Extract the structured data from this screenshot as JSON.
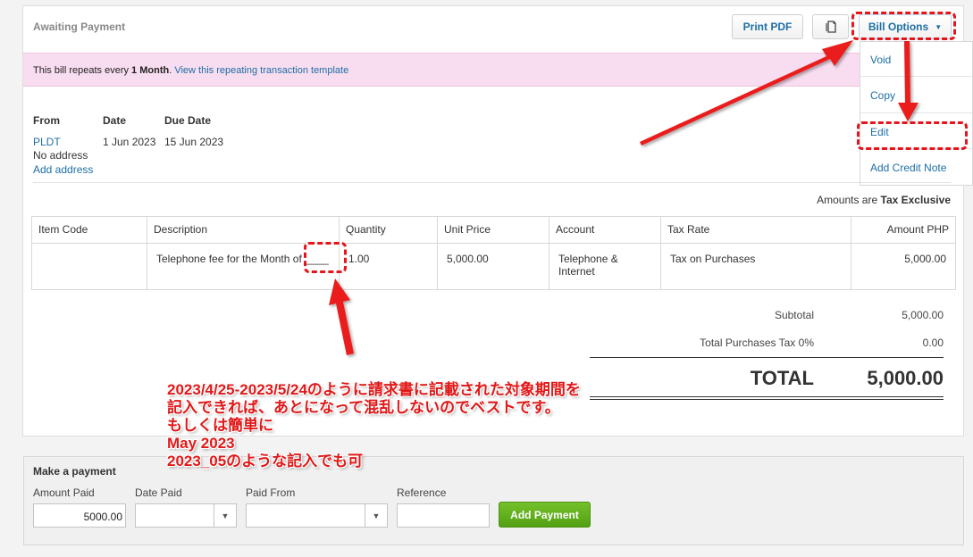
{
  "status": {
    "label": "Awaiting Payment"
  },
  "toolbar": {
    "print_label": "Print PDF",
    "copy_icon": "copy-icon",
    "bill_options_label": "Bill Options"
  },
  "menu": {
    "items": [
      {
        "label": "Void"
      },
      {
        "label": "Copy"
      },
      {
        "label": "Edit"
      },
      {
        "label": "Add Credit Note"
      }
    ]
  },
  "banner": {
    "text_prefix": "This bill repeats every ",
    "text_bold": "1 Month",
    "text_suffix": ".",
    "link": "View this repeating transaction template"
  },
  "bill": {
    "from_label": "From",
    "date_label": "Date",
    "due_label": "Due Date",
    "from_name": "PLDT",
    "from_address": "No address",
    "add_address": "Add address",
    "date": "1 Jun 2023",
    "due_date": "15 Jun 2023",
    "amounts_prefix": "Amounts are",
    "amounts_mode": "Tax Exclusive"
  },
  "table": {
    "headers": [
      "Item Code",
      "Description",
      "Quantity",
      "Unit Price",
      "Account",
      "Tax Rate",
      "Amount PHP"
    ],
    "rows": [
      {
        "item_code": "",
        "description": "Telephone fee for the Month of ____",
        "quantity": "1.00",
        "unit_price": "5,000.00",
        "account": "Telephone & Internet",
        "tax_rate": "Tax on Purchases",
        "amount": "5,000.00"
      }
    ]
  },
  "totals": {
    "subtotal_label": "Subtotal",
    "subtotal": "5,000.00",
    "tax_label": "Total Purchases Tax 0%",
    "tax": "0.00",
    "total_label": "TOTAL",
    "total": "5,000.00"
  },
  "annotation": {
    "lines": [
      "2023/4/25-2023/5/24のように請求書に記載された対象期間を",
      "記入できれば、あとになって混乱しないのでベストです。",
      "もしくは簡単に",
      "May 2023",
      "2023_05のような記入でも可"
    ],
    "color": "#e11818"
  },
  "payment": {
    "title": "Make a payment",
    "amount_label": "Amount Paid",
    "amount_value": "5000.00",
    "date_label": "Date Paid",
    "date_value": "",
    "from_label": "Paid From",
    "from_value": "",
    "reference_label": "Reference",
    "reference_value": "",
    "submit_label": "Add Payment"
  },
  "colors": {
    "link": "#1d6fa5",
    "banner": "#f8dcef",
    "add_payment": "#5aa91b",
    "highlight": "#e5151b"
  }
}
